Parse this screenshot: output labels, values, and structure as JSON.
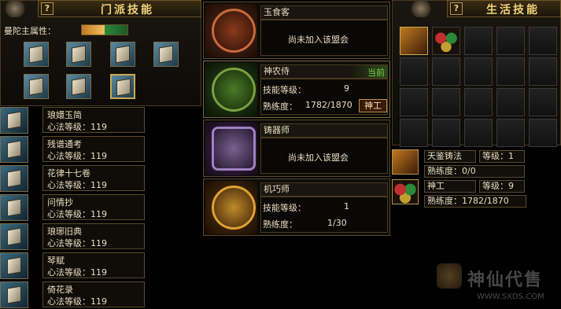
{
  "sect_panel": {
    "title": "门派技能",
    "help": "?",
    "attribute_label": "曼陀主属性："
  },
  "skills": [
    {
      "name": "琅嬛玉简",
      "level": "心法等级：119"
    },
    {
      "name": "残谱通考",
      "level": "心法等级：119"
    },
    {
      "name": "花律十七卷",
      "level": "心法等级：119"
    },
    {
      "name": "问情抄",
      "level": "心法等级：119"
    },
    {
      "name": "琅琊旧典",
      "level": "心法等级：119"
    },
    {
      "name": "琴赋",
      "level": "心法等级：119"
    },
    {
      "name": "倚花录",
      "level": "心法等级：119"
    }
  ],
  "alliances": [
    {
      "name": "玉食客",
      "status": "尚未加入该盟会",
      "tint": "#c86a3a"
    },
    {
      "name": "神农侍",
      "current": "当前",
      "skill_label": "技能等级：",
      "skill_value": "9",
      "prof_label": "熟练度：",
      "prof_value": "1782/1870",
      "button": "神工",
      "tint": "#5aa040"
    },
    {
      "name": "铸器师",
      "status": "尚未加入该盟会",
      "tint": "#a080c0"
    },
    {
      "name": "机巧师",
      "skill_label": "技能等级：",
      "skill_value": "1",
      "prof_label": "熟练度：",
      "prof_value": "1/30",
      "tint": "#e0a030"
    }
  ],
  "life_panel": {
    "title": "生活技能",
    "help": "?"
  },
  "life_info": {
    "skill1": "天鉴铸法",
    "level1": "等级：1",
    "prof1": "熟练度：0/0",
    "skill2": "神工",
    "level2": "等级：9",
    "prof2": "熟练度：1782/1870"
  },
  "watermark": {
    "brand": "神仙代售",
    "url": "WWW.SXDS.COM"
  }
}
